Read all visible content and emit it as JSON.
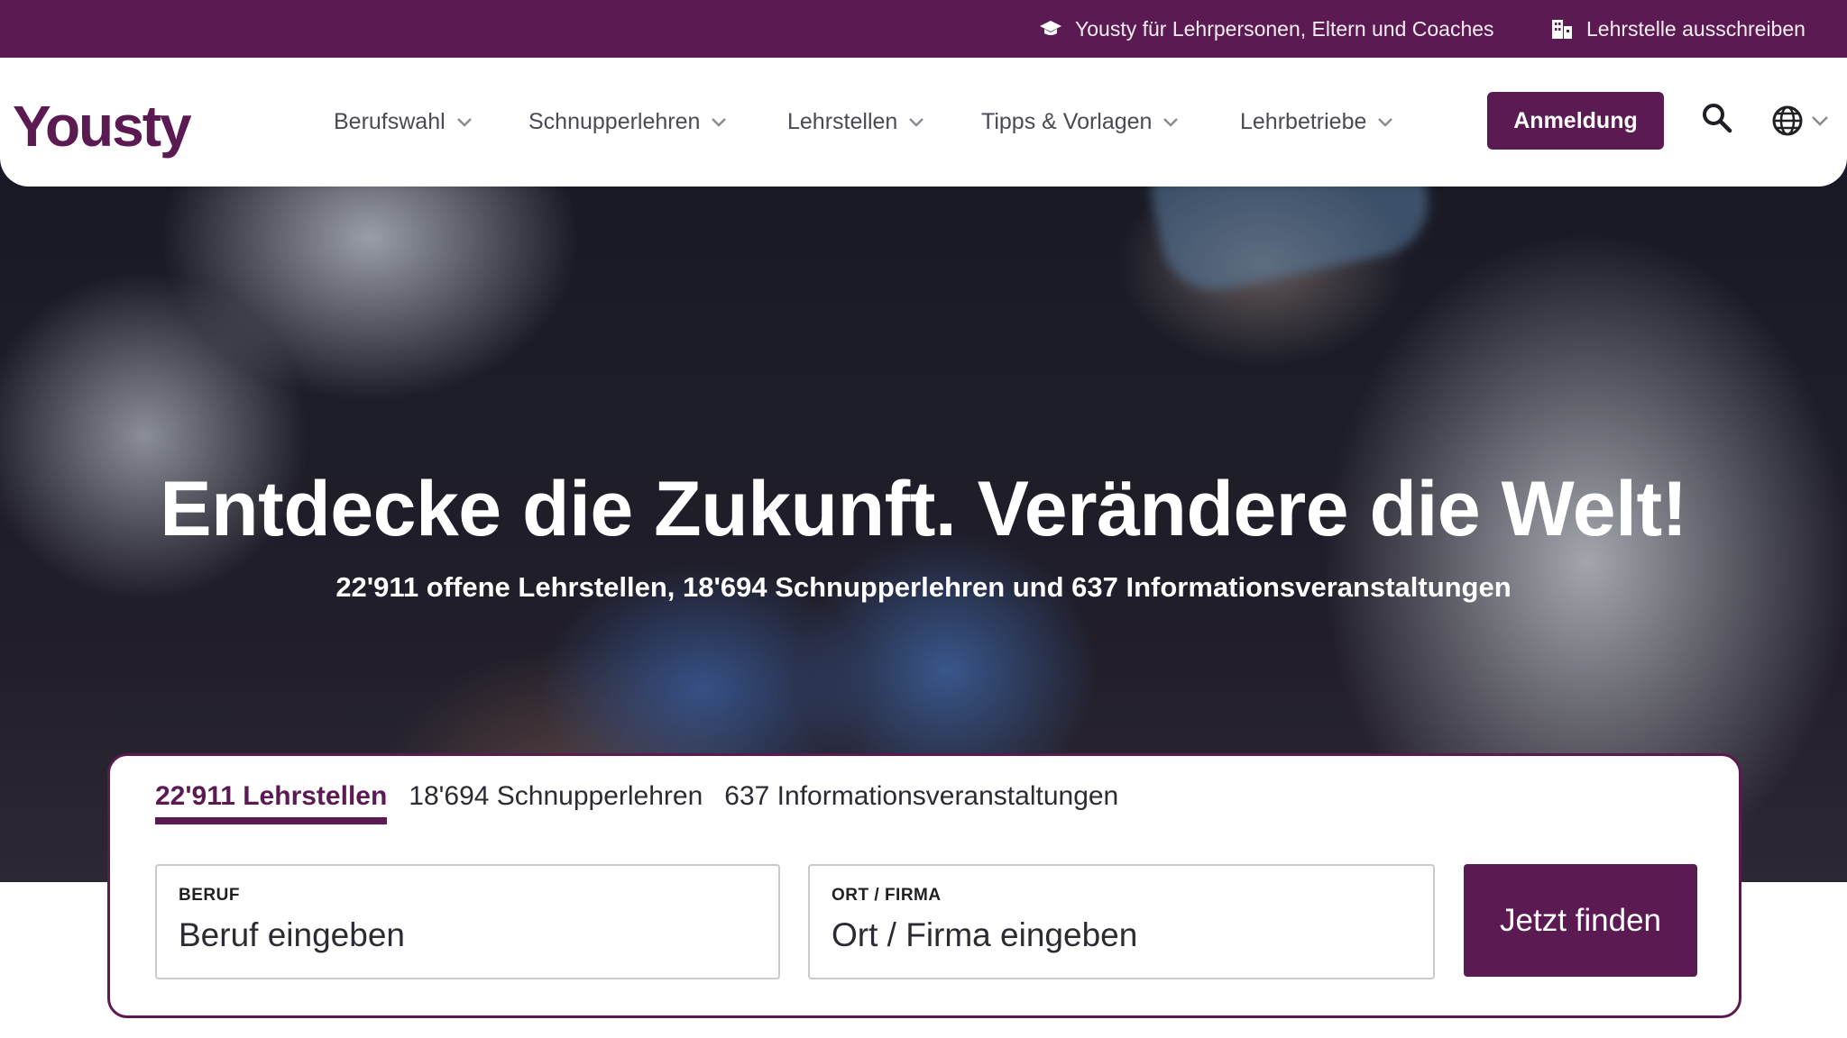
{
  "topbar": {
    "link1_label": "Yousty für Lehrpersonen, Eltern und Coaches",
    "link1_icon": "graduation-cap-icon",
    "link2_label": "Lehrstelle ausschreiben",
    "link2_icon": "building-icon"
  },
  "header": {
    "logo_text": "Yousty",
    "nav": [
      {
        "label": "Berufswahl"
      },
      {
        "label": "Schnupperlehren"
      },
      {
        "label": "Lehrstellen"
      },
      {
        "label": "Tipps & Vorlagen"
      },
      {
        "label": "Lehrbetriebe"
      }
    ],
    "login_label": "Anmeldung",
    "search_icon": "search-icon",
    "language_icon": "globe-icon"
  },
  "hero": {
    "title": "Entdecke die Zukunft. Verändere die Welt!",
    "subtitle": "22'911 offene Lehrstellen, 18'694 Schnupperlehren und 637 Informationsveranstaltungen"
  },
  "search": {
    "tabs": [
      {
        "label": "22'911 Lehrstellen",
        "active": true
      },
      {
        "label": "18'694 Schnupperlehren",
        "active": false
      },
      {
        "label": "637 Informationsveranstaltungen",
        "active": false
      }
    ],
    "field1_label": "BERUF",
    "field1_placeholder": "Beruf eingeben",
    "field2_label": "ORT / FIRMA",
    "field2_placeholder": "Ort / Firma eingeben",
    "submit_label": "Jetzt finden"
  },
  "colors": {
    "brand": "#5c1a52",
    "text": "#2b2b33",
    "nav_text": "#4a4a55"
  }
}
